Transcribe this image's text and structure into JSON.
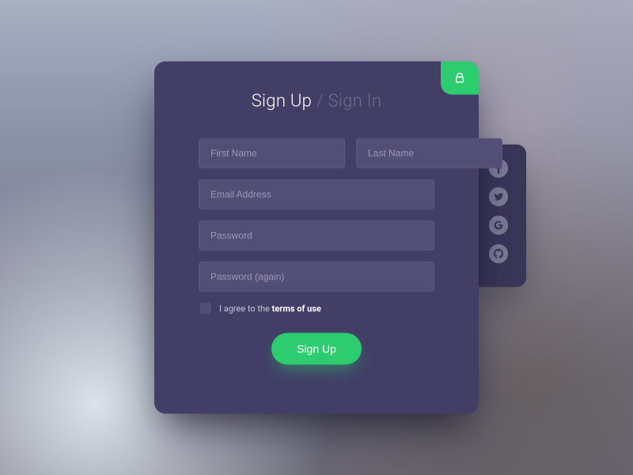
{
  "colors": {
    "card": "#423e66",
    "side": "#3a3658",
    "accent": "#2ecc71",
    "field": "#524e76"
  },
  "tabs": {
    "signup": "Sign Up",
    "separator": "/",
    "signin": "Sign In"
  },
  "fields": {
    "first_name": {
      "placeholder": "First Name",
      "value": ""
    },
    "last_name": {
      "placeholder": "Last Name",
      "value": ""
    },
    "email": {
      "placeholder": "Email Address",
      "value": ""
    },
    "password": {
      "placeholder": "Password",
      "value": ""
    },
    "password_again": {
      "placeholder": "Password (again)",
      "value": ""
    }
  },
  "terms": {
    "prefix": "I agree to the ",
    "link": "terms of use",
    "checked": false
  },
  "actions": {
    "submit": "Sign Up"
  },
  "social": {
    "facebook": "facebook-icon",
    "twitter": "twitter-icon",
    "google": "google-icon",
    "github": "github-icon"
  },
  "corner": {
    "icon": "lock-icon"
  }
}
